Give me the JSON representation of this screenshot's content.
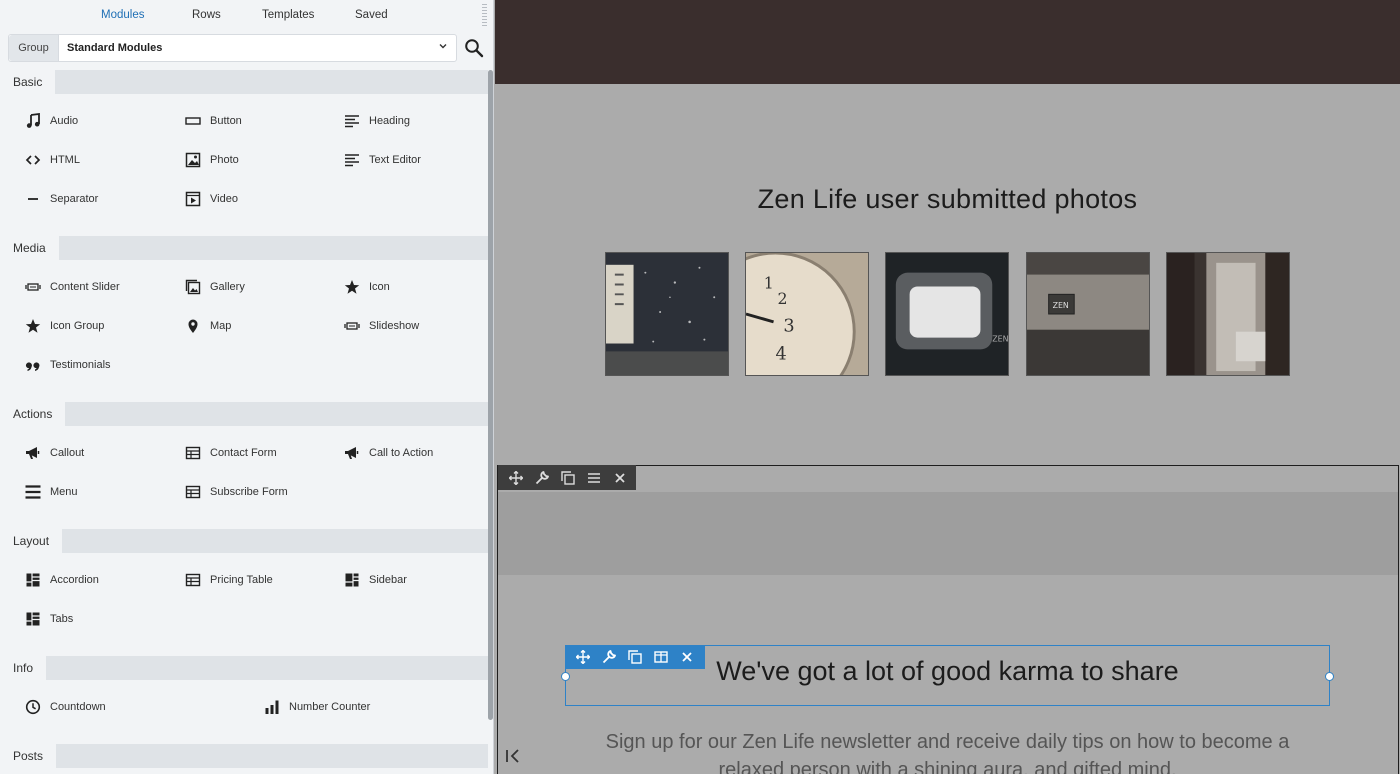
{
  "panel": {
    "tabs": [
      {
        "label": "Modules",
        "active": true
      },
      {
        "label": "Rows",
        "active": false
      },
      {
        "label": "Templates",
        "active": false
      },
      {
        "label": "Saved",
        "active": false
      }
    ],
    "group_label": "Group",
    "group_value": "Standard Modules",
    "accent": "#1f6fb5",
    "sections": {
      "basic": {
        "title": "Basic",
        "items": [
          {
            "label": "Audio",
            "icon": "music-note-icon"
          },
          {
            "label": "Button",
            "icon": "button-icon"
          },
          {
            "label": "Heading",
            "icon": "heading-icon"
          },
          {
            "label": "HTML",
            "icon": "code-icon"
          },
          {
            "label": "Photo",
            "icon": "photo-icon"
          },
          {
            "label": "Text Editor",
            "icon": "text-editor-icon"
          },
          {
            "label": "Separator",
            "icon": "separator-icon"
          },
          {
            "label": "Video",
            "icon": "video-icon"
          }
        ]
      },
      "media": {
        "title": "Media",
        "items": [
          {
            "label": "Content Slider",
            "icon": "slider-icon"
          },
          {
            "label": "Gallery",
            "icon": "gallery-icon"
          },
          {
            "label": "Icon",
            "icon": "star-icon"
          },
          {
            "label": "Icon Group",
            "icon": "star-icon"
          },
          {
            "label": "Map",
            "icon": "map-pin-icon"
          },
          {
            "label": "Slideshow",
            "icon": "slider-icon"
          },
          {
            "label": "Testimonials",
            "icon": "quote-icon"
          }
        ]
      },
      "actions": {
        "title": "Actions",
        "items": [
          {
            "label": "Callout",
            "icon": "megaphone-icon"
          },
          {
            "label": "Contact Form",
            "icon": "form-table-icon"
          },
          {
            "label": "Call to Action",
            "icon": "megaphone-icon"
          },
          {
            "label": "Menu",
            "icon": "menu-icon"
          },
          {
            "label": "Subscribe Form",
            "icon": "form-table-icon"
          }
        ]
      },
      "layout": {
        "title": "Layout",
        "items": [
          {
            "label": "Accordion",
            "icon": "layout-grid-icon"
          },
          {
            "label": "Pricing Table",
            "icon": "form-table-icon"
          },
          {
            "label": "Sidebar",
            "icon": "layout-grid-icon"
          },
          {
            "label": "Tabs",
            "icon": "layout-grid-icon"
          }
        ]
      },
      "info": {
        "title": "Info",
        "items": [
          {
            "label": "Countdown",
            "icon": "clock-icon"
          },
          {
            "label": "Number Counter",
            "icon": "bar-chart-icon"
          }
        ]
      },
      "posts": {
        "title": "Posts"
      }
    }
  },
  "canvas": {
    "photos_title": "Zen Life user submitted photos",
    "heading": "We've got a lot of good karma to share",
    "newsletter": "Sign up for our Zen Life newsletter and receive daily tips on how to become a relaxed person with a shining aura, and gifted mind.",
    "photo_labels": [
      "ZEN",
      "ZEN"
    ],
    "toolbar_accent": "#2e82c7",
    "hero_color": "#3a2e2d"
  }
}
